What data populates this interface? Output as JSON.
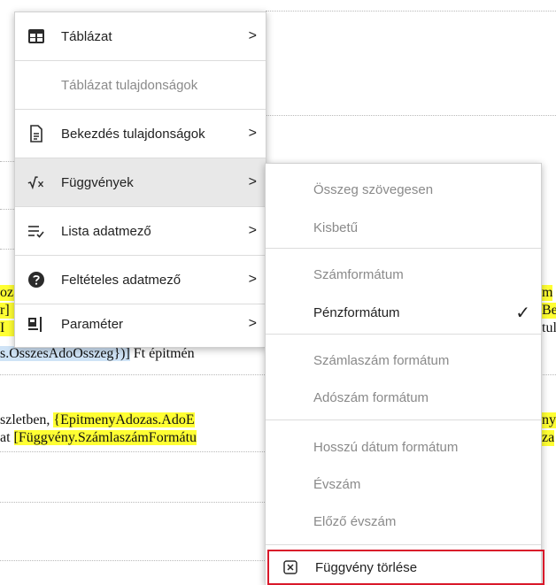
{
  "document": {
    "frag_a1": "oz",
    "frag_a2": "r]",
    "frag_a3": "I",
    "frag_selected": "s.OsszesAdoOsszeg})]",
    "frag_after_selected": " Ft épitmén",
    "frag_right1": "m",
    "frag_right2": "Be",
    "frag_right3": "tul",
    "line2_prefix": "szletben, ",
    "line2_highlight": "{EpitmenyAdozas.AdoE",
    "line2_right": "nyA",
    "line3_prefix": "at ",
    "line3_highlight": "[Függvény.SzámlaszámFormátu",
    "line3_right": "za"
  },
  "main_menu": {
    "items": [
      {
        "icon": "table-icon",
        "label": "Táblázat",
        "has_submenu": true,
        "enabled": true
      },
      {
        "icon": "",
        "label": "Táblázat tulajdonságok",
        "has_submenu": false,
        "enabled": false
      },
      {
        "icon": "paragraph-document-icon",
        "label": "Bekezdés tulajdonságok",
        "has_submenu": true,
        "enabled": true
      },
      {
        "icon": "function-sqrt-icon",
        "label": "Függvények",
        "has_submenu": true,
        "enabled": true,
        "active": true
      },
      {
        "icon": "list-field-icon",
        "label": "Lista adatmező",
        "has_submenu": true,
        "enabled": true
      },
      {
        "icon": "question-circle-icon",
        "label": "Feltételes adatmező",
        "has_submenu": true,
        "enabled": true
      },
      {
        "icon": "parameter-icon",
        "label": "Paraméter",
        "has_submenu": true,
        "enabled": true
      }
    ],
    "arrow_glyph": ">"
  },
  "functions_submenu": {
    "items": [
      {
        "label": "Összeg szövegesen",
        "enabled": false
      },
      {
        "label": "Kisbetű",
        "enabled": false
      },
      {
        "label": "Számformátum",
        "enabled": false
      },
      {
        "label": "Pénzformátum",
        "enabled": true,
        "checked": true
      },
      {
        "label": "Számlaszám formátum",
        "enabled": false
      },
      {
        "label": "Adószám formátum",
        "enabled": false
      },
      {
        "label": "Hosszú dátum formátum",
        "enabled": false
      },
      {
        "label": "Évszám",
        "enabled": false
      },
      {
        "label": "Előző évszám",
        "enabled": false
      },
      {
        "label": "Függvény törlése",
        "enabled": true,
        "icon": "close-box-icon"
      }
    ],
    "check_glyph": "✓",
    "highlight_color": "#d9182a"
  }
}
